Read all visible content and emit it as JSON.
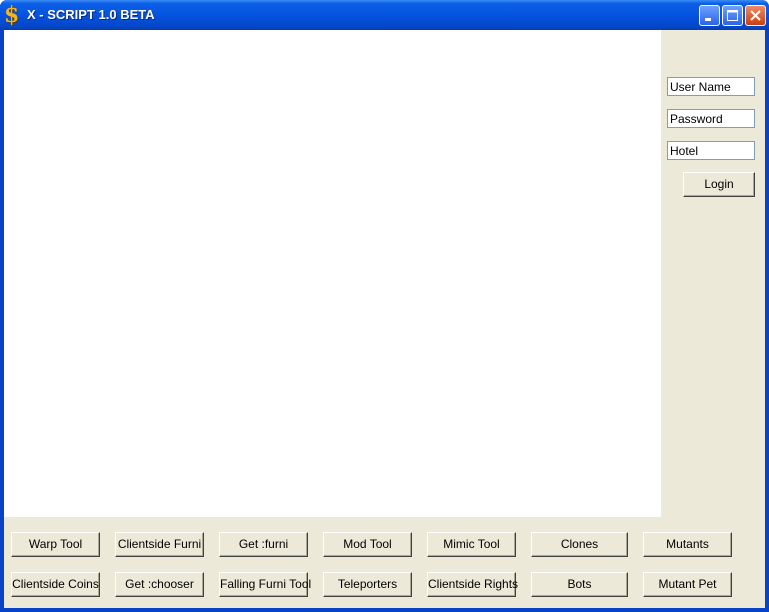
{
  "window": {
    "title": "X - SCRIPT 1.0 BETA",
    "icon": "dollar-icon",
    "controls": {
      "minimize": "minimize-icon",
      "maximize": "maximize-icon",
      "close": "close-icon"
    }
  },
  "login": {
    "username": "User Name",
    "password": "Password",
    "hotel": "Hotel",
    "login_label": "Login"
  },
  "tools": {
    "row1": [
      "Warp Tool",
      "Clientside Furni",
      "Get :furni",
      "Mod Tool",
      "Mimic Tool",
      "Clones",
      "Mutants"
    ],
    "row2": [
      "Clientside Coins",
      "Get :chooser",
      "Falling Furni Tool",
      "Teleporters",
      "Clientside Rights",
      "Bots",
      "Mutant Pet"
    ]
  },
  "colors": {
    "titlebar": "#0553e0",
    "window_bg": "#ece9d8",
    "close_button": "#c8400e",
    "app_icon": "#f2b51c"
  }
}
